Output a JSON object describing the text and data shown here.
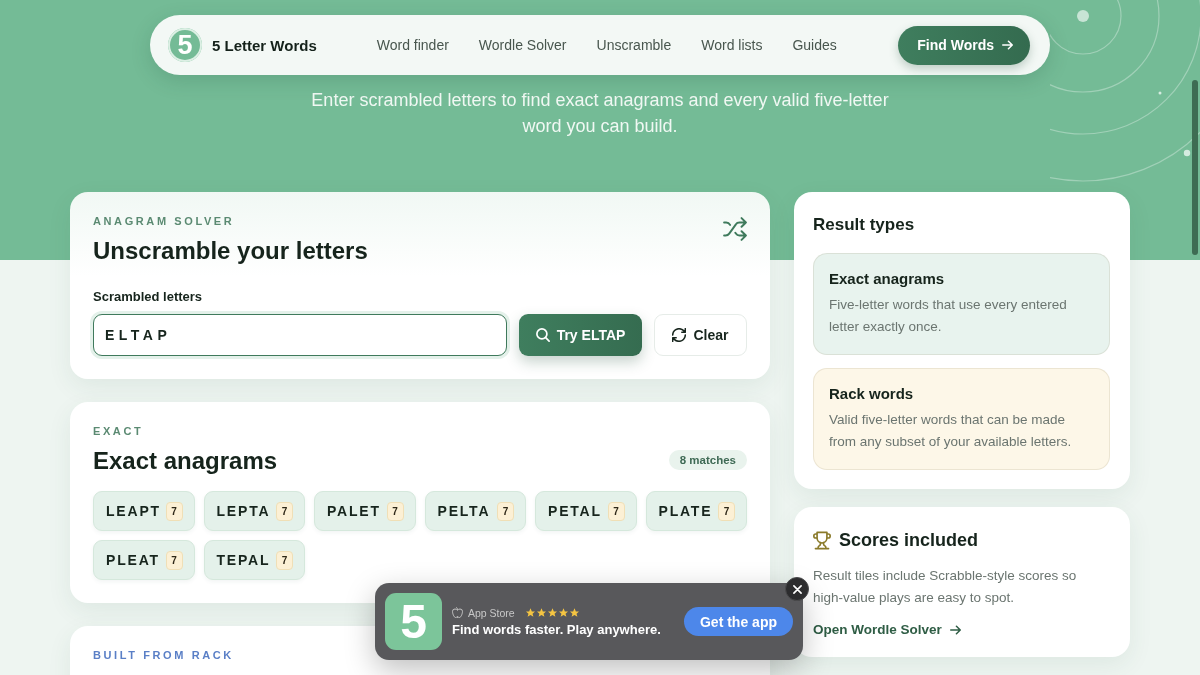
{
  "nav": {
    "logo_mark": "5",
    "brand": "5 Letter Words",
    "links": [
      "Word finder",
      "Wordle Solver",
      "Unscramble",
      "Word lists",
      "Guides"
    ],
    "cta": "Find Words"
  },
  "hero": {
    "subtitle": "Enter scrambled letters to find exact anagrams and every valid five-letter word you can build."
  },
  "solver": {
    "eyebrow": "ANAGRAM SOLVER",
    "title": "Unscramble your letters",
    "field": {
      "label": "Scrambled letters",
      "value": "ELTAP"
    },
    "buttons": [
      {
        "kind": "primary",
        "label": "Try ELTAP"
      },
      {
        "kind": "secondary",
        "label": "Clear"
      }
    ]
  },
  "exact": {
    "eyebrow": "EXACT",
    "title": "Exact anagrams",
    "count": "8 matches",
    "tiles": [
      {
        "word": "LEAPT",
        "score": "7"
      },
      {
        "word": "LEPTA",
        "score": "7"
      },
      {
        "word": "PALET",
        "score": "7"
      },
      {
        "word": "PELTA",
        "score": "7"
      },
      {
        "word": "PETAL",
        "score": "7"
      },
      {
        "word": "PLATE",
        "score": "7"
      },
      {
        "word": "PLEAT",
        "score": "7"
      },
      {
        "word": "TEPAL",
        "score": "7"
      }
    ]
  },
  "rack": {
    "eyebrow": "BUILT FROM RACK"
  },
  "result_types": {
    "title": "Result types",
    "items": [
      {
        "title": "Exact anagrams",
        "text": "Five-letter words that use every entered letter exactly once.",
        "color": "#e8f3ee"
      },
      {
        "title": "Rack words",
        "text": "Valid five-letter words that can be made from any subset of your available letters.",
        "color": "#fdf7e8"
      }
    ]
  },
  "scores": {
    "title": "Scores included",
    "text": "Result tiles include Scrabble-style scores so high-value plays are easy to spot.",
    "link": "Open Wordle Solver"
  },
  "app_banner": {
    "icon_mark": "5",
    "store": "App Store",
    "stars": 5,
    "tagline": "Find words faster. Play anywhere.",
    "button": "Get the app"
  }
}
